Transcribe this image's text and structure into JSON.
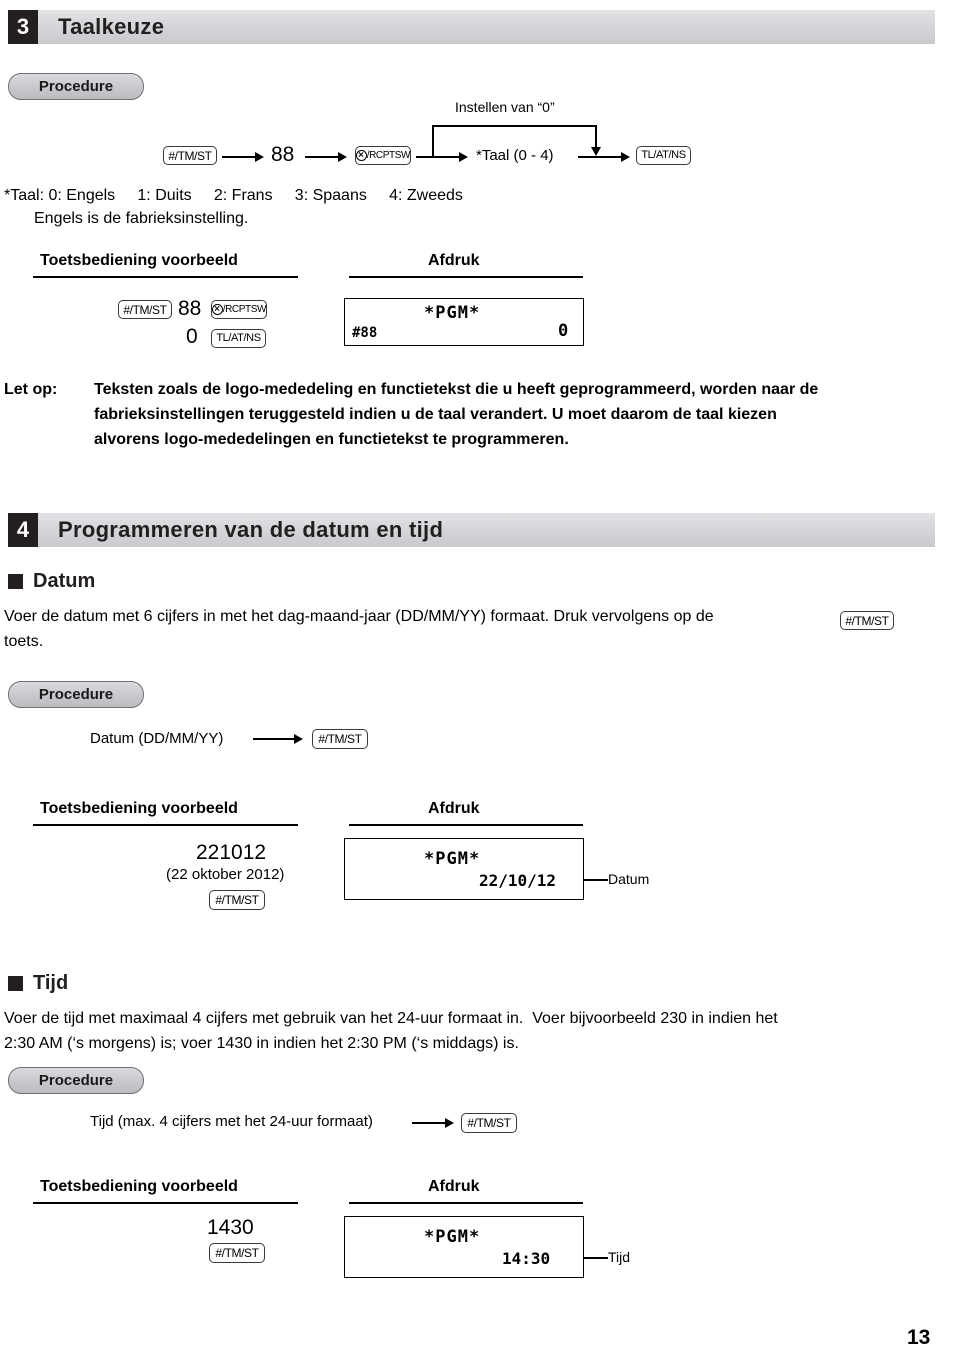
{
  "page": {
    "number": "13"
  },
  "section3": {
    "number": "3",
    "title": "Taalkeuze",
    "procedure_label": "Procedure",
    "flow": {
      "key1": "#/TM/ST",
      "value1": "88",
      "key2": "/RCPTSW",
      "node3": "*Taal (0 - 4)",
      "key4": "TL/AT/NS",
      "bypass_label": "Instellen van “0”"
    },
    "note_line1": "*Taal: 0: Engels     1: Duits     2: Frans     3: Spaans     4: Zweeds",
    "note_line2": "Engels is de fabrieksinstelling.",
    "example": {
      "keyop_header": "Toetsbediening voorbeeld",
      "print_header": "Afdruk",
      "row1_key1": "#/TM/ST",
      "row1_value": "88",
      "row1_key2": "/RCPTSW",
      "row2_value": "0",
      "row2_key": "TL/AT/NS",
      "receipt_left": "#88",
      "receipt_center": "*PGM*",
      "receipt_right": "0"
    },
    "letop_label": "Let op:",
    "letop_line1": "Teksten zoals de logo-mededeling en functietekst die u heeft geprogrammeerd, worden naar de",
    "letop_line2": "fabrieksinstellingen teruggesteld indien u de taal verandert. U moet daarom de taal kiezen",
    "letop_line3": "alvorens logo-mededelingen en functietekst te programmeren."
  },
  "section4": {
    "number": "4",
    "title": "Programmeren van de datum en tijd",
    "datum": {
      "heading": "Datum",
      "body_part1": "Voer de datum met 6 cijfers in met het dag-maand-jaar (DD/MM/YY) formaat. Druk vervolgens op de",
      "body_key": "#/TM/ST",
      "body_part2": "toets.",
      "procedure_label": "Procedure",
      "flow_node": "Datum (DD/MM/YY)",
      "flow_key": "#/TM/ST",
      "example": {
        "keyop_header": "Toetsbediening voorbeeld",
        "print_header": "Afdruk",
        "value": "221012",
        "value_note": "(22 oktober 2012)",
        "key": "#/TM/ST",
        "receipt_center": "*PGM*",
        "receipt_value": "22/10/12",
        "callout": "Datum"
      }
    },
    "tijd": {
      "heading": "Tijd",
      "body_line1": "Voer de tijd met maximaal 4 cijfers met gebruik van het 24-uur formaat in.  Voer bijvoorbeeld 230 in indien het",
      "body_line2": "2:30 AM (‘s morgens) is; voer 1430 in indien het 2:30 PM (‘s middags) is.",
      "procedure_label": "Procedure",
      "flow_node": "Tijd (max. 4 cijfers met het 24-uur formaat)",
      "flow_key": "#/TM/ST",
      "example": {
        "keyop_header": "Toetsbediening voorbeeld",
        "print_header": "Afdruk",
        "value": "1430",
        "key": "#/TM/ST",
        "receipt_center": "*PGM*",
        "receipt_value": "14:30",
        "callout": "Tijd"
      }
    }
  }
}
